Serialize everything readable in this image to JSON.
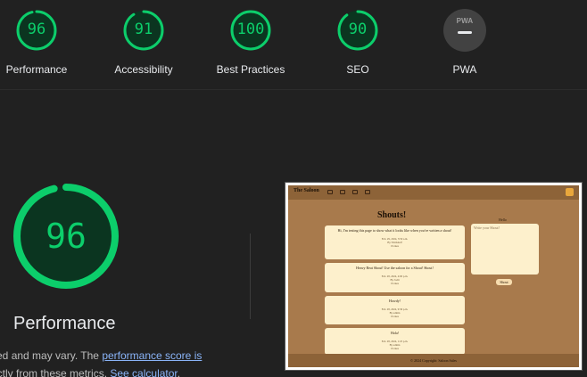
{
  "summary": {
    "gauges": [
      {
        "score": "96",
        "label": "Performance",
        "value": 96
      },
      {
        "score": "91",
        "label": "Accessibility",
        "value": 91
      },
      {
        "score": "100",
        "label": "Best Practices",
        "value": 100
      },
      {
        "score": "90",
        "label": "SEO",
        "value": 90
      }
    ],
    "pwa": {
      "badge_text": "PWA",
      "label": "PWA"
    }
  },
  "performance": {
    "score": "96",
    "value": 96,
    "title": "Performance",
    "desc_line1": "ated and may vary. The",
    "score_link": "performance score is",
    "desc_line2": "rectly from these metrics.",
    "calculator_link": "See calculator",
    "desc_end": "."
  },
  "screenshot": {
    "brand": "The Saloon",
    "heading": "Shouts!",
    "posts": [
      {
        "text": "Hi, I'm testing this page to show what it looks like when you've written a shout!",
        "meta1": "Feb. 29, 2024, 3:59 a.m.",
        "meta2": "By Ymilsitelf",
        "meta3": "0 Likes"
      },
      {
        "text": "Heavy Beat Shout! Use the saloon for a Shout! Shout!",
        "meta1": "Feb. 28, 2024, 4:00 p.m.",
        "meta2": "By Jodii",
        "meta3": "0 Likes"
      },
      {
        "text": "Howdy!",
        "meta1": "Feb. 28, 2024, 9:36 p.m.",
        "meta2": "By admin",
        "meta3": "0 Likes"
      },
      {
        "text": "Hola!",
        "meta1": "Feb. 28, 2024, 1:25 p.m.",
        "meta2": "By admin",
        "meta3": "0 Likes"
      }
    ],
    "side_title": "Hello",
    "textarea_placeholder": "Write your Shout!",
    "button": "Shout",
    "footer": "© 2024 Copyright: Saloon Sales"
  },
  "colors": {
    "pass_green": "#0cce6b",
    "background": "#212121",
    "link": "#8ab4f8"
  }
}
